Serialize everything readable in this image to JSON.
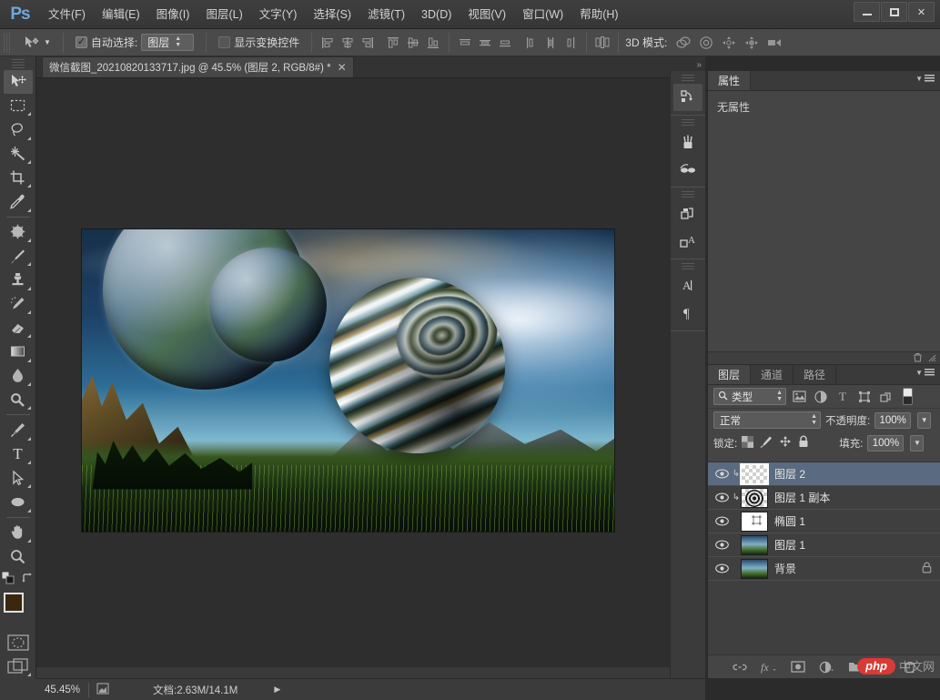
{
  "app": {
    "logo": "Ps",
    "window_controls": {
      "minimize": "minimize-icon",
      "maximize": "maximize-icon",
      "close": "✕"
    }
  },
  "menubar": {
    "items": [
      {
        "label": "文件(F)"
      },
      {
        "label": "编辑(E)"
      },
      {
        "label": "图像(I)"
      },
      {
        "label": "图层(L)"
      },
      {
        "label": "文字(Y)"
      },
      {
        "label": "选择(S)"
      },
      {
        "label": "滤镜(T)"
      },
      {
        "label": "3D(D)"
      },
      {
        "label": "视图(V)"
      },
      {
        "label": "窗口(W)"
      },
      {
        "label": "帮助(H)"
      }
    ]
  },
  "optionsbar": {
    "tool_icon": "move-tool-icon",
    "auto_select_checked": "✓",
    "auto_select_label": "自动选择:",
    "auto_select_value": "图层",
    "show_transform_label": "显示变换控件",
    "align_icons": [
      "align-left-edges-icon",
      "align-horizontal-centers-icon",
      "align-right-edges-icon",
      "align-top-edges-icon",
      "align-vertical-centers-icon",
      "align-bottom-edges-icon"
    ],
    "distribute_icons": [
      "distribute-top-edges-icon",
      "distribute-vertical-centers-icon",
      "distribute-bottom-edges-icon",
      "distribute-left-edges-icon",
      "distribute-horizontal-centers-icon",
      "distribute-right-edges-icon"
    ],
    "auto_align_icon": "auto-align-layers-icon",
    "mode3d_label": "3D 模式:",
    "mode3d_icons": [
      "rotate-3d-icon",
      "roll-3d-icon",
      "drag-3d-icon",
      "slide-3d-icon",
      "scale-3d-icon"
    ]
  },
  "document": {
    "tab_title": "微信截图_20210820133717.jpg @ 45.5% (图层 2, RGB/8#) *",
    "close_glyph": "✕"
  },
  "toolbox": {
    "tools": [
      {
        "name": "move-tool",
        "active": true
      },
      {
        "name": "rectangular-marquee-tool",
        "active": false
      },
      {
        "name": "lasso-tool",
        "active": false
      },
      {
        "name": "magic-wand-tool",
        "active": false
      },
      {
        "name": "crop-tool",
        "active": false
      },
      {
        "name": "eyedropper-tool",
        "active": false
      },
      {
        "name": "spot-healing-brush-tool",
        "active": false
      },
      {
        "name": "brush-tool",
        "active": false
      },
      {
        "name": "clone-stamp-tool",
        "active": false
      },
      {
        "name": "history-brush-tool",
        "active": false
      },
      {
        "name": "eraser-tool",
        "active": false
      },
      {
        "name": "gradient-tool",
        "active": false
      },
      {
        "name": "blur-tool",
        "active": false
      },
      {
        "name": "dodge-tool",
        "active": false
      },
      {
        "name": "pen-tool",
        "active": false
      },
      {
        "name": "horizontal-type-tool",
        "active": false,
        "glyph": "T"
      },
      {
        "name": "path-selection-tool",
        "active": false
      },
      {
        "name": "ellipse-tool",
        "active": false
      },
      {
        "name": "hand-tool",
        "active": false
      },
      {
        "name": "zoom-tool",
        "active": false
      }
    ],
    "foreground_color": "#3b2610",
    "background_color": "#000000",
    "quick_mask_name": "quick-mask-icon",
    "screen_mode_name": "screen-mode-icon"
  },
  "rail": {
    "groups": [
      {
        "items": [
          {
            "name": "history-panel-icon"
          }
        ]
      },
      {
        "items": [
          {
            "name": "brush-presets-icon"
          },
          {
            "name": "clone-source-icon"
          }
        ]
      },
      {
        "items": [
          {
            "name": "layer-comps-icon"
          },
          {
            "name": "glyphs-panel-icon"
          }
        ]
      },
      {
        "items": [
          {
            "name": "character-panel-icon",
            "glyph": "A"
          },
          {
            "name": "paragraph-panel-icon",
            "glyph": "¶"
          }
        ]
      }
    ]
  },
  "properties_panel": {
    "tabs": [
      {
        "label": "属性",
        "active": true
      }
    ],
    "empty_text": "无属性",
    "menu_icon": "panel-menu-icon"
  },
  "layers_panel": {
    "tabs": [
      {
        "label": "图层",
        "active": true
      },
      {
        "label": "通道",
        "active": false
      },
      {
        "label": "路径",
        "active": false
      }
    ],
    "menu_icon": "panel-menu-icon",
    "filter": {
      "search_icon": "search-icon",
      "type_label": "类型",
      "icons": [
        "filter-pixel-layers-icon",
        "filter-adjustment-layers-icon",
        "filter-type-layers-icon",
        "filter-shape-layers-icon",
        "filter-smart-objects-icon"
      ],
      "toggle_name": "filter-toggle-switch"
    },
    "blend_mode": "正常",
    "opacity_label": "不透明度:",
    "opacity_value": "100%",
    "lock_label": "锁定:",
    "lock_icons": [
      "lock-transparent-pixels-icon",
      "lock-image-pixels-icon",
      "lock-position-icon",
      "lock-all-icon"
    ],
    "fill_label": "填充:",
    "fill_value": "100%",
    "layers": [
      {
        "name": "图层 2",
        "visible": true,
        "selected": true,
        "thumb": "checker",
        "clipped": true,
        "locked": false,
        "has_mask": false
      },
      {
        "name": "图层 1 副本",
        "visible": true,
        "selected": false,
        "thumb": "swirl",
        "clipped": true,
        "locked": false,
        "has_mask": false
      },
      {
        "name": "椭圆 1",
        "visible": true,
        "selected": false,
        "thumb": "white",
        "clipped": false,
        "locked": false,
        "has_mask": true
      },
      {
        "name": "图层 1",
        "visible": true,
        "selected": false,
        "thumb": "photo",
        "clipped": false,
        "locked": false,
        "has_mask": false
      },
      {
        "name": "背景",
        "visible": true,
        "selected": false,
        "thumb": "photo",
        "clipped": false,
        "locked": true,
        "has_mask": false
      }
    ],
    "bottom_buttons": [
      {
        "name": "link-layers-button",
        "glyph": "link-icon"
      },
      {
        "name": "layer-style-button",
        "glyph": "fx-icon"
      },
      {
        "name": "add-layer-mask-button",
        "glyph": "mask-icon"
      },
      {
        "name": "new-fill-adjustment-button",
        "glyph": "adjustment-icon"
      },
      {
        "name": "new-group-button",
        "glyph": "folder-icon"
      },
      {
        "name": "new-layer-button",
        "glyph": "new-layer-icon"
      },
      {
        "name": "delete-layer-button",
        "glyph": "trash-icon"
      }
    ]
  },
  "statusbar": {
    "zoom_value": "45.45%",
    "doc_icon": "document-info-icon",
    "doc_info": "文档:2.63M/14.1M",
    "expand_glyph": "▶"
  },
  "watermark": {
    "brand": "php",
    "suffix": "中文网"
  },
  "canvas": {
    "artboard_alt": "fantasy landscape with planets and striped sphere"
  },
  "colors": {
    "chrome_bg": "#3b3b3b",
    "panel_bg": "#454545",
    "canvas_bg": "#2e2e2e",
    "selection_blue": "#5a6a80",
    "accent_logo": "#6fa8dc",
    "watermark_red": "#d93a34"
  }
}
